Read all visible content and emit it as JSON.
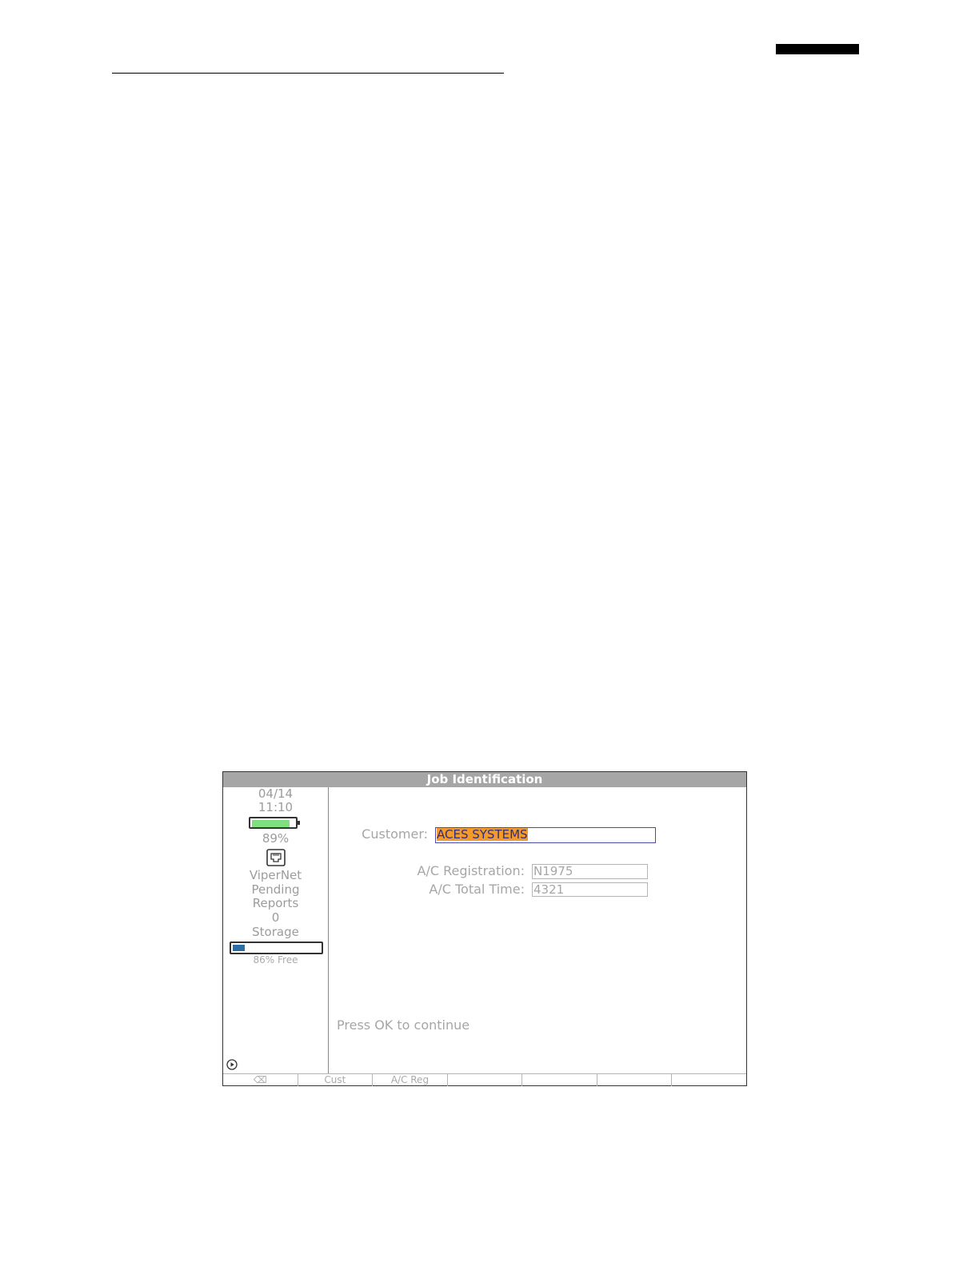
{
  "screen": {
    "title": "Job Identification",
    "status": {
      "date": "04/14",
      "time": "11:10",
      "battery_percent": 89,
      "battery_label": "89%",
      "battery_color": "#7fe07f",
      "network_icon": "ethernet-port-icon",
      "network_name": "ViperNet",
      "pending_label_1": "Pending",
      "pending_label_2": "Reports",
      "pending_count": "0",
      "storage_label": "Storage",
      "storage_used_fraction": 0.14,
      "storage_free_label": "86% Free",
      "storage_color": "#2e6da4"
    },
    "form": {
      "customer_label": "Customer:",
      "customer_value": "ACES SYSTEMS",
      "registration_label": "A/C Registration:",
      "registration_value": "N1975",
      "total_time_label": "A/C Total Time:",
      "total_time_value": "4321"
    },
    "hint": "Press OK to continue",
    "softkeys": [
      "⌫",
      "Cust",
      "A/C Reg",
      "",
      "",
      "",
      ""
    ],
    "accent_color": "#f39a2c"
  }
}
